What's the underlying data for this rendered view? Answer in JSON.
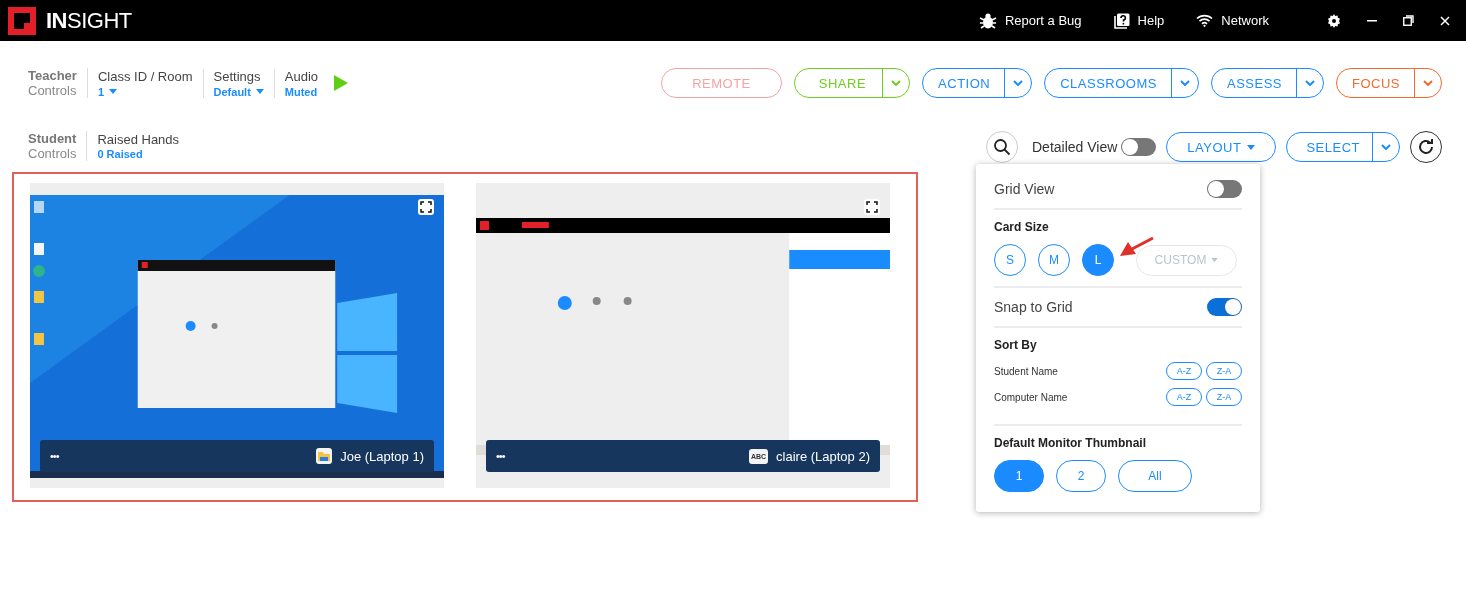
{
  "title_bar": {
    "logo": "**IN**SIGHT",
    "items": [
      {
        "kind": "bug",
        "label": "Report a Bug"
      },
      {
        "kind": "help",
        "label": "Help"
      },
      {
        "kind": "network",
        "label": "Network"
      }
    ],
    "window_controls": [
      {
        "kind": "settings"
      },
      {
        "kind": "minimize"
      },
      {
        "kind": "restore"
      },
      {
        "kind": "close"
      }
    ]
  },
  "teacher_controls": {
    "title": "Teacher",
    "subtitle": "Controls",
    "groups": [
      {
        "label": "Class ID / Room",
        "value": "1",
        "dropdown": true
      },
      {
        "label": "Settings",
        "value": "Default",
        "dropdown": true
      },
      {
        "label": "Audio",
        "value": "Muted",
        "dropdown": false
      }
    ],
    "play": true
  },
  "action_buttons": [
    {
      "label": "REMOTE",
      "color": "#f4a3a3",
      "split": false
    },
    {
      "label": "SHARE",
      "color": "#6dcf1c",
      "split": true
    },
    {
      "label": "ACTION",
      "color": "#1a8cff",
      "split": true
    },
    {
      "label": "CLASSROOMS",
      "color": "#1a8cff",
      "split": true
    },
    {
      "label": "ASSESS",
      "color": "#1a8cff",
      "split": true
    },
    {
      "label": "FOCUS",
      "color": "#f26a2e",
      "split": true
    }
  ],
  "student_controls": {
    "title": "Student",
    "subtitle": "Controls",
    "groups": [
      {
        "label": "Raised Hands",
        "value": "0 Raised"
      }
    ]
  },
  "toolbar": {
    "detailed_view": {
      "label": "Detailed View",
      "on": false
    },
    "layout": {
      "label": "LAYOUT"
    },
    "select": {
      "label": "SELECT"
    }
  },
  "layout_menu": {
    "grid_view": {
      "label": "Grid View",
      "on": false
    },
    "card_size": {
      "title": "Card Size",
      "options": [
        {
          "label": "S",
          "selected": false
        },
        {
          "label": "M",
          "selected": false
        },
        {
          "label": "L",
          "selected": true
        }
      ],
      "custom": {
        "label": "CUSTOM",
        "disabled": true
      }
    },
    "snap_to_grid": {
      "label": "Snap to Grid",
      "on": true
    },
    "sort_by": {
      "title": "Sort By",
      "rows": [
        {
          "label": "Student Name",
          "options": [
            "A-Z",
            "Z-A"
          ]
        },
        {
          "label": "Computer Name",
          "options": [
            "A-Z",
            "Z-A"
          ]
        }
      ]
    },
    "default_monitor": {
      "title": "Default Monitor Thumbnail",
      "options": [
        {
          "label": "1",
          "selected": true
        },
        {
          "label": "2",
          "selected": false
        },
        {
          "label": "All",
          "selected": false
        }
      ]
    }
  },
  "student_cards": [
    {
      "name": "Joe (Laptop 1)",
      "menu": "•••",
      "screen": {
        "kind": "desktop"
      },
      "app_icon": {
        "kind": "folder"
      }
    },
    {
      "name": "claire (Laptop 2)",
      "menu": "•••",
      "screen": {
        "kind": "app"
      },
      "app_icon": {
        "kind": "text",
        "text": "ABC"
      }
    }
  ]
}
